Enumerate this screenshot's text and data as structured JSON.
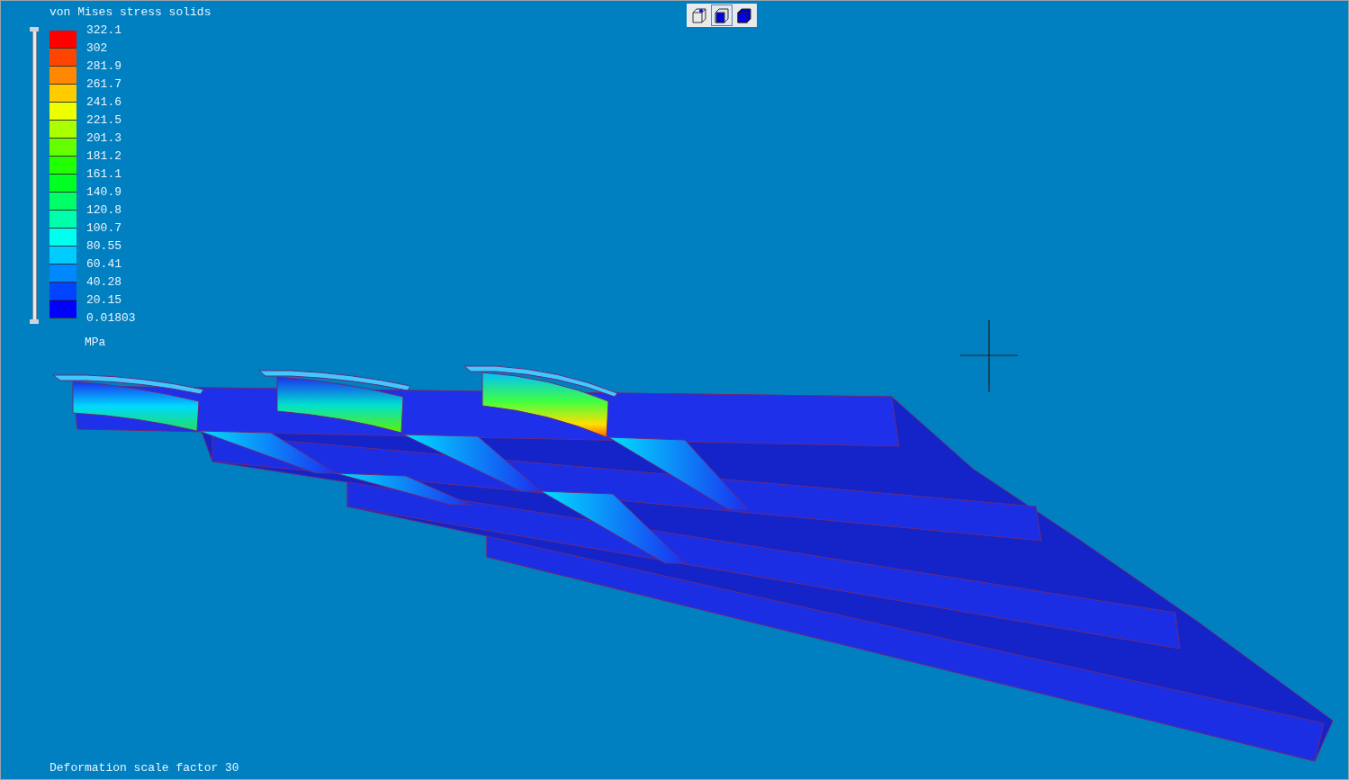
{
  "legend": {
    "title": "von Mises stress solids",
    "bands": [
      {
        "color": "#ff0000"
      },
      {
        "color": "#ff4400"
      },
      {
        "color": "#ff8800"
      },
      {
        "color": "#ffcc00"
      },
      {
        "color": "#eeff00"
      },
      {
        "color": "#aaff00"
      },
      {
        "color": "#66ff00"
      },
      {
        "color": "#22ff00"
      },
      {
        "color": "#00ff22"
      },
      {
        "color": "#00ff66"
      },
      {
        "color": "#00ffaa"
      },
      {
        "color": "#00ffee"
      },
      {
        "color": "#00ccff"
      },
      {
        "color": "#0088ff"
      },
      {
        "color": "#0044ff"
      },
      {
        "color": "#0000ff"
      }
    ],
    "labels": [
      "322.1",
      "302",
      "281.9",
      "261.7",
      "241.6",
      "221.5",
      "201.3",
      "181.2",
      "161.1",
      "140.9",
      "120.8",
      "100.7",
      "80.55",
      "60.41",
      "40.28",
      "20.15",
      "0.01803"
    ],
    "unit": "MPa",
    "range_slider": {
      "level": 1
    }
  },
  "toolbar": [
    {
      "kind": "wireframe",
      "selected": false
    },
    {
      "kind": "shaded-edges",
      "selected": true
    },
    {
      "kind": "shaded",
      "selected": false
    }
  ],
  "footer": "Deformation scale factor 30"
}
